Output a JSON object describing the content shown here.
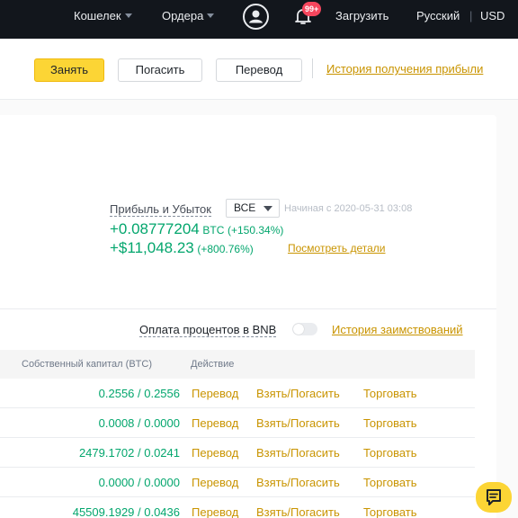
{
  "topbar": {
    "wallet": "Кошелек",
    "orders": "Ордера",
    "notifications_badge": "99+",
    "download": "Загрузить",
    "language": "Русский",
    "separator": "|",
    "currency": "USD"
  },
  "actions": {
    "borrow": "Занять",
    "repay": "Погасить",
    "transfer": "Перевод",
    "profit_history": "История получения прибыли"
  },
  "pnl": {
    "label": "Прибыль и Убыток",
    "filter_value": "ВСЕ",
    "since": "Начиная с 2020-05-31 03:08",
    "btc_value": "+0.08777204",
    "btc_unit": "BTC",
    "btc_pct": "(+150.34%)",
    "usd_value": "+$11,048.23",
    "usd_pct": "(+800.76%)",
    "details_link": "Посмотреть детали"
  },
  "options": {
    "bnb_interest": "Оплата процентов в BNB",
    "bnb_toggle_on": false,
    "borrow_history": "История заимствований"
  },
  "table": {
    "headers": {
      "equity": "Собственный капитал (BTC)",
      "action": "Действие"
    },
    "rows": [
      {
        "equity": "0.2556 / 0.2556",
        "transfer": "Перевод",
        "borrow_repay": "Взять/Погасить",
        "trade": "Торговать"
      },
      {
        "equity": "0.0008 / 0.0000",
        "transfer": "Перевод",
        "borrow_repay": "Взять/Погасить",
        "trade": "Торговать"
      },
      {
        "equity": "2479.1702 / 0.0241",
        "transfer": "Перевод",
        "borrow_repay": "Взять/Погасить",
        "trade": "Торговать"
      },
      {
        "equity": "0.0000 / 0.0000",
        "transfer": "Перевод",
        "borrow_repay": "Взять/Погасить",
        "trade": "Торговать"
      },
      {
        "equity": "45509.1929 / 0.0436",
        "transfer": "Перевод",
        "borrow_repay": "Взять/Погасить",
        "trade": "Торговать"
      }
    ]
  },
  "icons": {
    "user": "user-icon",
    "bell": "bell-icon",
    "chat": "chat-icon"
  },
  "colors": {
    "accent": "#fcd535",
    "link": "#c99400",
    "positive": "#03a66d",
    "topbar": "#12161c",
    "badge": "#f6465d"
  }
}
